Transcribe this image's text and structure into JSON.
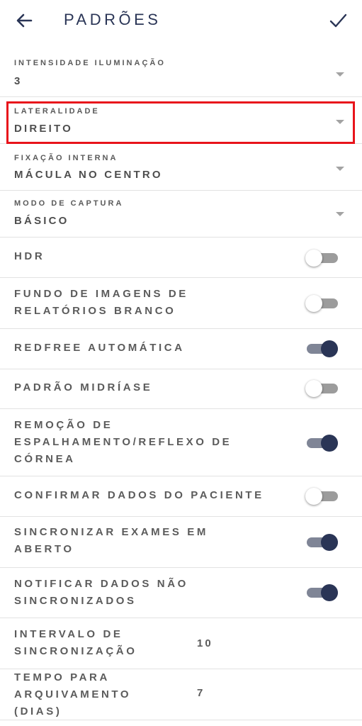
{
  "header": {
    "title": "PADRÕES",
    "back_icon": "arrow-left-icon",
    "confirm_icon": "check-icon",
    "accent": "#2a3556"
  },
  "selects": [
    {
      "label": "INTENSIDADE ILUMINAÇÃO",
      "value": "3"
    },
    {
      "label": "LATERALIDADE",
      "value": "DIREITO",
      "highlighted": true
    },
    {
      "label": "FIXAÇÃO INTERNA",
      "value": "MÁCULA NO CENTRO"
    },
    {
      "label": "MODO DE CAPTURA",
      "value": "BÁSICO"
    }
  ],
  "toggles": [
    {
      "label": "HDR",
      "on": false
    },
    {
      "label": "FUNDO DE IMAGENS DE RELATÓRIOS BRANCO",
      "on": false
    },
    {
      "label": "REDFREE AUTOMÁTICA",
      "on": true
    },
    {
      "label": "PADRÃO MIDRÍASE",
      "on": false
    },
    {
      "label": "REMOÇÃO DE ESPALHAMENTO/REFLEXO DE CÓRNEA",
      "on": true
    },
    {
      "label": "CONFIRMAR DADOS DO PACIENTE",
      "on": false
    },
    {
      "label": "SINCRONIZAR EXAMES EM ABERTO",
      "on": true
    },
    {
      "label": "NOTIFICAR DADOS NÃO SINCRONIZADOS",
      "on": true
    }
  ],
  "numeric": [
    {
      "label": "INTERVALO DE SINCRONIZAÇÃO",
      "value": "10"
    },
    {
      "label": "TEMPO PARA ARQUIVAMENTO (DIAS)",
      "value": "7"
    }
  ],
  "colors": {
    "highlight_border": "#e8131b",
    "toggle_on_knob": "#2a3556",
    "toggle_on_track": "#7f8596",
    "toggle_off_track": "#9c9c9c"
  }
}
